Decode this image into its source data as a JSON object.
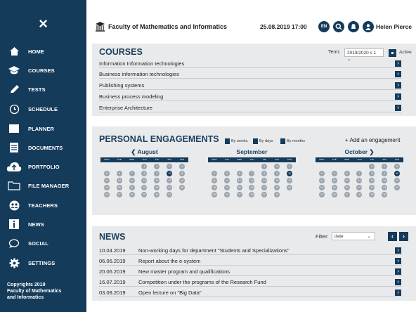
{
  "sidebar": {
    "close_icon": "×",
    "items": [
      {
        "label": "HOME",
        "icon": "home-icon"
      },
      {
        "label": "COURSES",
        "icon": "graduation-cap-icon"
      },
      {
        "label": "TESTS",
        "icon": "pencil-icon"
      },
      {
        "label": "SCHEDULE",
        "icon": "clock-icon"
      },
      {
        "label": "PLANNER",
        "icon": "planner-icon"
      },
      {
        "label": "DOCUMENTS",
        "icon": "documents-icon"
      },
      {
        "label": "PORTFOLIO",
        "icon": "cloud-upload-icon"
      },
      {
        "label": "FILE MANAGER",
        "icon": "folder-icon"
      },
      {
        "label": "TEACHERS",
        "icon": "teachers-icon"
      },
      {
        "label": "NEWS",
        "icon": "info-icon"
      },
      {
        "label": "SOCIAL",
        "icon": "chat-bubble-icon"
      },
      {
        "label": "SETTINGS",
        "icon": "gear-icon"
      }
    ],
    "copyright": "Copyrights 2019\nFaculty of Mathematics\nand Informatics"
  },
  "header": {
    "faculty": "Faculty of Mathematics and Informatics",
    "datetime": "25.08.2019  17:00",
    "lang": "EN",
    "user": "Helen Pierce"
  },
  "courses": {
    "title": "COURSES",
    "term_label": "Term:",
    "term_value": "2019/2020 s 1",
    "active_label": "Active",
    "items": [
      "Information Information technologies",
      "Business information technologies",
      "Publishing systems",
      "Business process modeling",
      "Enterprise Architecture"
    ]
  },
  "engagements": {
    "title": "PERSONAL ENGAGEMENTS",
    "views": [
      "By weeks",
      "By days",
      "By months"
    ],
    "add_label": "+ Add an engagement",
    "weekdays": [
      "MON",
      "TUE",
      "WED",
      "THU",
      "FRI",
      "SAT",
      "SUN"
    ],
    "months": [
      {
        "name": "August",
        "prev": "❮",
        "next": "",
        "offset": 3,
        "days": 31,
        "highlight": 10
      },
      {
        "name": "September",
        "prev": "",
        "next": "",
        "offset": 4,
        "days": 30,
        "highlight": 10
      },
      {
        "name": "October",
        "prev": "",
        "next": "❯",
        "offset": 4,
        "days": 30,
        "highlight": 10
      }
    ]
  },
  "news": {
    "title": "NEWS",
    "filter_label": "Filter:",
    "filter_value": "date",
    "items": [
      {
        "date": "10.04.2019",
        "title": "Non-working days for department \"Students and Specializations\""
      },
      {
        "date": "06.06.2019",
        "title": "Report about the e-system"
      },
      {
        "date": "20.06.2019",
        "title": "New master program and qualifications"
      },
      {
        "date": "16.07.2019",
        "title": "Competition under the programs of the Research Fund"
      },
      {
        "date": "03.08.2019",
        "title": "Open lecture on \"Big Data\""
      }
    ]
  },
  "colors": {
    "accent": "#153b5b",
    "panel": "#e8eaec"
  }
}
